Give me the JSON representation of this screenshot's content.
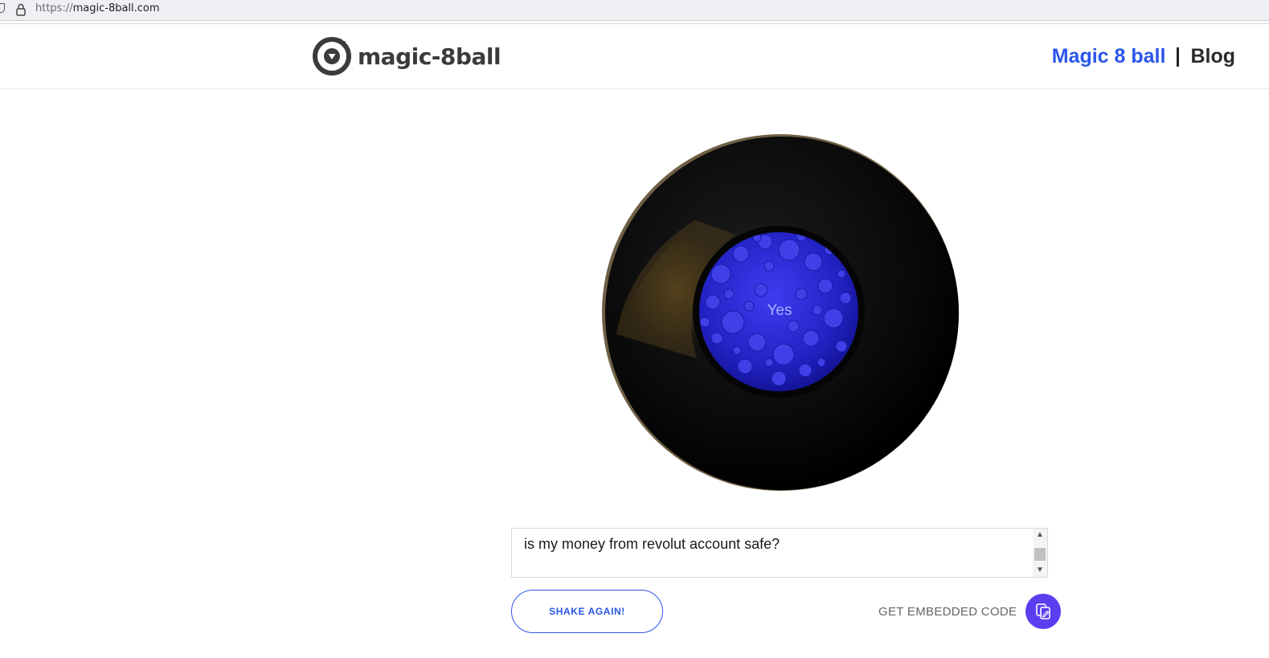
{
  "browser": {
    "url_protocol": "https://",
    "url_host": "magic-8ball.com"
  },
  "header": {
    "logo_text": "magic-8ball",
    "nav": [
      {
        "label": "Magic 8 ball",
        "color": "#2a55e8"
      },
      {
        "label": "Blog",
        "color": "#2b2b2b"
      }
    ]
  },
  "ball": {
    "answer": "Yes",
    "window_color": "#2f2fd6"
  },
  "question": {
    "value": "is my money from revolut account safe?"
  },
  "actions": {
    "shake_label": "SHAKE AGAIN!",
    "embed_label": "GET EMBEDDED CODE"
  },
  "colors": {
    "accent": "#2a55e8",
    "embed_button": "#5a3ff0"
  }
}
